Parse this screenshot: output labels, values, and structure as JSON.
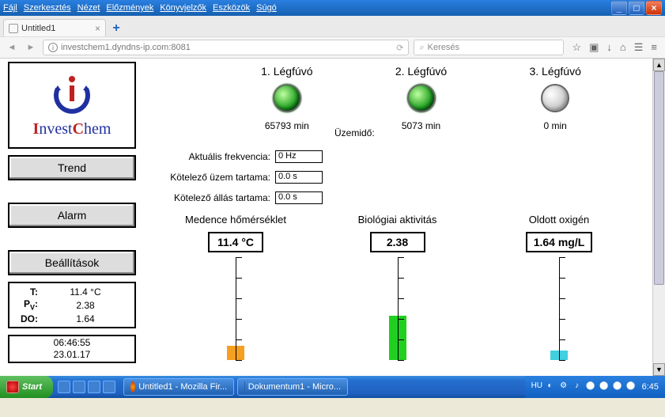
{
  "window": {
    "menu": [
      "Fájl",
      "Szerkesztés",
      "Nézet",
      "Előzmények",
      "Könyvjelzők",
      "Eszközök",
      "Súgó"
    ]
  },
  "browser": {
    "tab_title": "Untitled1",
    "url": "investchem1.dyndns-ip.com:8081",
    "search_placeholder": "Keresés"
  },
  "logo": {
    "brand_a": "I",
    "brand_b": "nvest",
    "brand_c": "C",
    "brand_d": "hem"
  },
  "sidebar": {
    "trend": "Trend",
    "alarm": "Alarm",
    "settings": "Beállítások",
    "readings": {
      "t_lbl": "T:",
      "t_val": "11.4  °C",
      "pv_lbl": "P",
      "pv_sub": "V",
      "pv_colon": ":",
      "pv_val": "2.38",
      "do_lbl": "DO:",
      "do_val": "1.64"
    },
    "datetime": {
      "time": "06:46:55",
      "date": "23.01.17"
    }
  },
  "blowers": {
    "labels": [
      "1. Légfúvó",
      "2. Légfúvó",
      "3. Légfúvó"
    ],
    "uptime_label": "Üzemidő:",
    "uptimes": [
      "65793  min",
      "5073  min",
      "0  min"
    ],
    "status": [
      "on",
      "on",
      "off"
    ]
  },
  "params": {
    "freq_label": "Aktuális frekvencia:",
    "freq_val": "0  Hz",
    "run_label": "Kötelező üzem tartama:",
    "run_val": "0.0  s",
    "stop_label": "Kötelező állás tartama:",
    "stop_val": "0.0  s"
  },
  "gauges": {
    "temp": {
      "title": "Medence hőmérséklet",
      "value": "11.4  °C"
    },
    "bio": {
      "title": "Biológiai aktivitás",
      "value": "2.38"
    },
    "do": {
      "title": "Oldott oxigén",
      "value": "1.64  mg/L"
    }
  },
  "chart_data": [
    {
      "type": "bar",
      "title": "Medence hőmérséklet",
      "categories": [
        ""
      ],
      "values": [
        11.4
      ],
      "ylabel": "°C",
      "ylim": [
        0,
        100
      ]
    },
    {
      "type": "bar",
      "title": "Biológiai aktivitás",
      "categories": [
        ""
      ],
      "values": [
        2.38
      ],
      "ylabel": "",
      "ylim": [
        0,
        5
      ]
    },
    {
      "type": "bar",
      "title": "Oldott oxigén",
      "categories": [
        ""
      ],
      "values": [
        1.64
      ],
      "ylabel": "mg/L",
      "ylim": [
        0,
        20
      ]
    }
  ],
  "taskbar": {
    "start": "Start",
    "tasks": [
      "Untitled1 - Mozilla Fir...",
      "Dokumentum1 - Micro..."
    ],
    "tray_label": "HU",
    "clock": "6:45"
  }
}
